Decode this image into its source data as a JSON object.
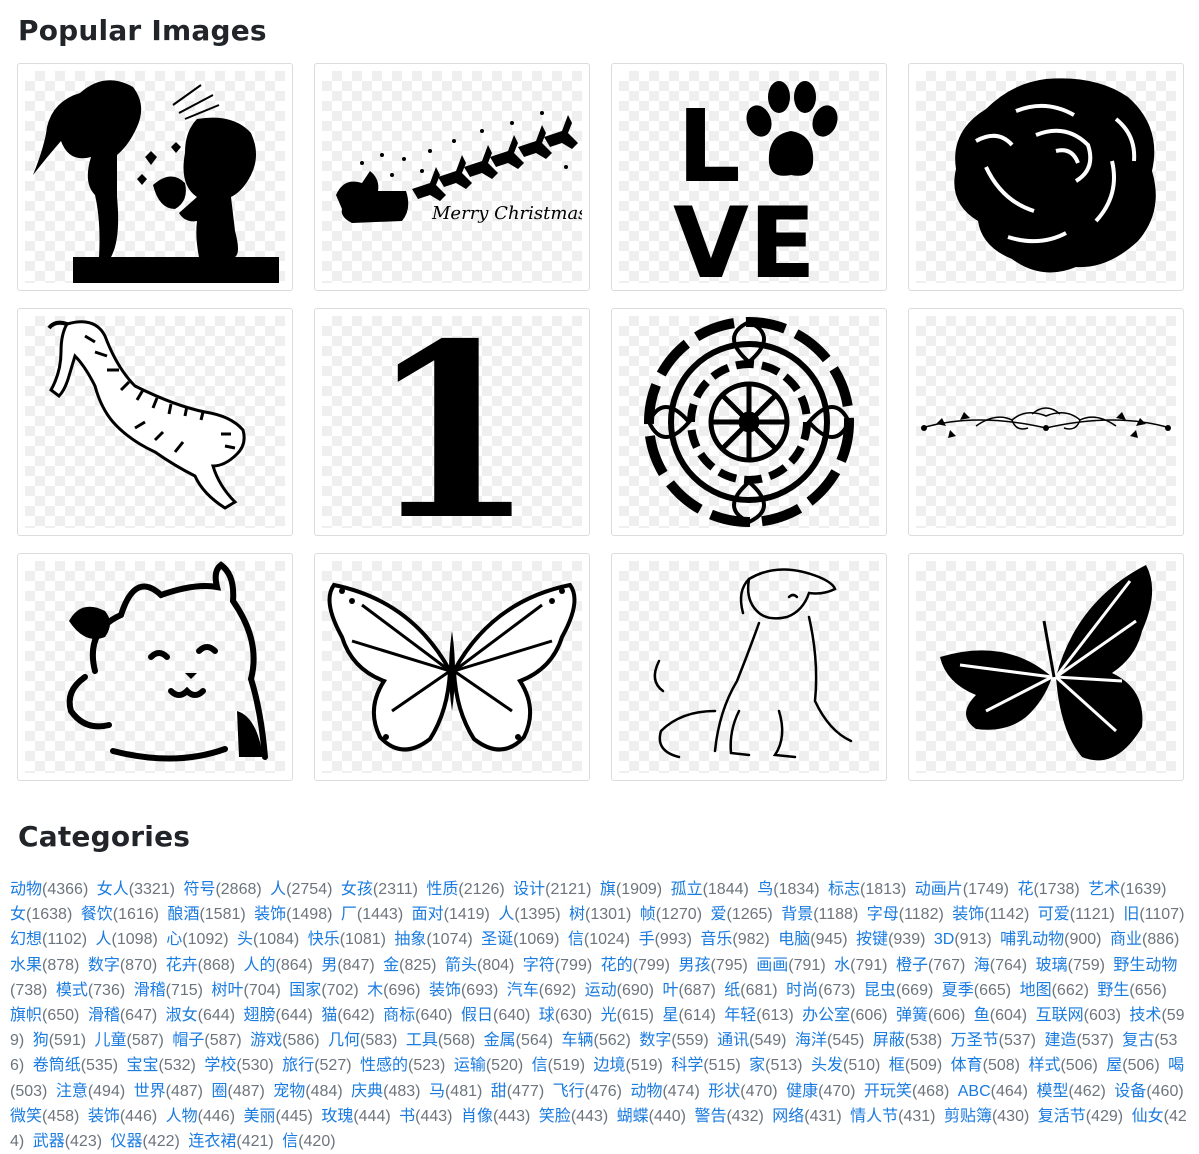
{
  "popular": {
    "title": "Popular Images",
    "images": [
      {
        "icon": "couple-silhouette-icon"
      },
      {
        "icon": "santa-sleigh-icon",
        "caption": "Merry Christmas"
      },
      {
        "icon": "love-paw-icon",
        "letters_top": "L",
        "letters_bottom": "VE"
      },
      {
        "icon": "rose-icon"
      },
      {
        "icon": "tiger-icon"
      },
      {
        "icon": "number-one-icon",
        "text": "1"
      },
      {
        "icon": "mandala-icon"
      },
      {
        "icon": "floral-divider-icon"
      },
      {
        "icon": "lucky-cat-icon"
      },
      {
        "icon": "butterfly-outline-icon"
      },
      {
        "icon": "dog-line-art-icon"
      },
      {
        "icon": "butterfly-silhouette-icon"
      }
    ]
  },
  "categories": {
    "title": "Categories",
    "link_color": "#1a7be0",
    "items": [
      {
        "name": "动物",
        "count": "(4366)"
      },
      {
        "name": "女人",
        "count": "(3321)"
      },
      {
        "name": "符号",
        "count": "(2868)"
      },
      {
        "name": "人",
        "count": "(2754)"
      },
      {
        "name": "女孩",
        "count": "(2311)"
      },
      {
        "name": "性质",
        "count": "(2126)"
      },
      {
        "name": "设计",
        "count": "(2121)"
      },
      {
        "name": "旗",
        "count": "(1909)"
      },
      {
        "name": "孤立",
        "count": "(1844)"
      },
      {
        "name": "鸟",
        "count": "(1834)"
      },
      {
        "name": "标志",
        "count": "(1813)"
      },
      {
        "name": "动画片",
        "count": "(1749)"
      },
      {
        "name": "花",
        "count": "(1738)"
      },
      {
        "name": "艺术",
        "count": "(1639)"
      },
      {
        "name": "女",
        "count": "(1638)"
      },
      {
        "name": "餐饮",
        "count": "(1616)"
      },
      {
        "name": "酿酒",
        "count": "(1581)"
      },
      {
        "name": "装饰",
        "count": "(1498)"
      },
      {
        "name": "厂",
        "count": "(1443)"
      },
      {
        "name": "面对",
        "count": "(1419)"
      },
      {
        "name": "人",
        "count": "(1395)"
      },
      {
        "name": "树",
        "count": "(1301)"
      },
      {
        "name": "帧",
        "count": "(1270)"
      },
      {
        "name": "爱",
        "count": "(1265)"
      },
      {
        "name": "背景",
        "count": "(1188)"
      },
      {
        "name": "字母",
        "count": "(1182)"
      },
      {
        "name": "装饰",
        "count": "(1142)"
      },
      {
        "name": "可爱",
        "count": "(1121)"
      },
      {
        "name": "旧",
        "count": "(1107)"
      },
      {
        "name": "幻想",
        "count": "(1102)"
      },
      {
        "name": "人",
        "count": "(1098)"
      },
      {
        "name": "心",
        "count": "(1092)"
      },
      {
        "name": "头",
        "count": "(1084)"
      },
      {
        "name": "快乐",
        "count": "(1081)"
      },
      {
        "name": "抽象",
        "count": "(1074)"
      },
      {
        "name": "圣诞",
        "count": "(1069)"
      },
      {
        "name": "信",
        "count": "(1024)"
      },
      {
        "name": "手",
        "count": "(993)"
      },
      {
        "name": "音乐",
        "count": "(982)"
      },
      {
        "name": "电脑",
        "count": "(945)"
      },
      {
        "name": "按键",
        "count": "(939)"
      },
      {
        "name": "3D",
        "count": "(913)"
      },
      {
        "name": "哺乳动物",
        "count": "(900)"
      },
      {
        "name": "商业",
        "count": "(886)"
      },
      {
        "name": "水果",
        "count": "(878)"
      },
      {
        "name": "数字",
        "count": "(870)"
      },
      {
        "name": "花卉",
        "count": "(868)"
      },
      {
        "name": "人的",
        "count": "(864)"
      },
      {
        "name": "男",
        "count": "(847)"
      },
      {
        "name": "金",
        "count": "(825)"
      },
      {
        "name": "箭头",
        "count": "(804)"
      },
      {
        "name": "字符",
        "count": "(799)"
      },
      {
        "name": "花的",
        "count": "(799)"
      },
      {
        "name": "男孩",
        "count": "(795)"
      },
      {
        "name": "画画",
        "count": "(791)"
      },
      {
        "name": "水",
        "count": "(791)"
      },
      {
        "name": "橙子",
        "count": "(767)"
      },
      {
        "name": "海",
        "count": "(764)"
      },
      {
        "name": "玻璃",
        "count": "(759)"
      },
      {
        "name": "野生动物",
        "count": "(738)"
      },
      {
        "name": "模式",
        "count": "(736)"
      },
      {
        "name": "滑稽",
        "count": "(715)"
      },
      {
        "name": "树叶",
        "count": "(704)"
      },
      {
        "name": "国家",
        "count": "(702)"
      },
      {
        "name": "木",
        "count": "(696)"
      },
      {
        "name": "装饰",
        "count": "(693)"
      },
      {
        "name": "汽车",
        "count": "(692)"
      },
      {
        "name": "运动",
        "count": "(690)"
      },
      {
        "name": "叶",
        "count": "(687)"
      },
      {
        "name": "纸",
        "count": "(681)"
      },
      {
        "name": "时尚",
        "count": "(673)"
      },
      {
        "name": "昆虫",
        "count": "(669)"
      },
      {
        "name": "夏季",
        "count": "(665)"
      },
      {
        "name": "地图",
        "count": "(662)"
      },
      {
        "name": "野生",
        "count": "(656)"
      },
      {
        "name": "旗帜",
        "count": "(650)"
      },
      {
        "name": "滑稽",
        "count": "(647)"
      },
      {
        "name": "淑女",
        "count": "(644)"
      },
      {
        "name": "翅膀",
        "count": "(644)"
      },
      {
        "name": "猫",
        "count": "(642)"
      },
      {
        "name": "商标",
        "count": "(640)"
      },
      {
        "name": "假日",
        "count": "(640)"
      },
      {
        "name": "球",
        "count": "(630)"
      },
      {
        "name": "光",
        "count": "(615)"
      },
      {
        "name": "星",
        "count": "(614)"
      },
      {
        "name": "年轻",
        "count": "(613)"
      },
      {
        "name": "办公室",
        "count": "(606)"
      },
      {
        "name": "弹簧",
        "count": "(606)"
      },
      {
        "name": "鱼",
        "count": "(604)"
      },
      {
        "name": "互联网",
        "count": "(603)"
      },
      {
        "name": "技术",
        "count": "(599)"
      },
      {
        "name": "狗",
        "count": "(591)"
      },
      {
        "name": "儿童",
        "count": "(587)"
      },
      {
        "name": "帽子",
        "count": "(587)"
      },
      {
        "name": "游戏",
        "count": "(586)"
      },
      {
        "name": "几何",
        "count": "(583)"
      },
      {
        "name": "工具",
        "count": "(568)"
      },
      {
        "name": "金属",
        "count": "(564)"
      },
      {
        "name": "车辆",
        "count": "(562)"
      },
      {
        "name": "数字",
        "count": "(559)"
      },
      {
        "name": "通讯",
        "count": "(549)"
      },
      {
        "name": "海洋",
        "count": "(545)"
      },
      {
        "name": "屏蔽",
        "count": "(538)"
      },
      {
        "name": "万圣节",
        "count": "(537)"
      },
      {
        "name": "建造",
        "count": "(537)"
      },
      {
        "name": "复古",
        "count": "(536)"
      },
      {
        "name": "卷筒纸",
        "count": "(535)"
      },
      {
        "name": "宝宝",
        "count": "(532)"
      },
      {
        "name": "学校",
        "count": "(530)"
      },
      {
        "name": "旅行",
        "count": "(527)"
      },
      {
        "name": "性感的",
        "count": "(523)"
      },
      {
        "name": "运输",
        "count": "(520)"
      },
      {
        "name": "信",
        "count": "(519)"
      },
      {
        "name": "边境",
        "count": "(519)"
      },
      {
        "name": "科学",
        "count": "(515)"
      },
      {
        "name": "家",
        "count": "(513)"
      },
      {
        "name": "头发",
        "count": "(510)"
      },
      {
        "name": "框",
        "count": "(509)"
      },
      {
        "name": "体育",
        "count": "(508)"
      },
      {
        "name": "样式",
        "count": "(506)"
      },
      {
        "name": "屋",
        "count": "(506)"
      },
      {
        "name": "喝",
        "count": "(503)"
      },
      {
        "name": "注意",
        "count": "(494)"
      },
      {
        "name": "世界",
        "count": "(487)"
      },
      {
        "name": "圈",
        "count": "(487)"
      },
      {
        "name": "宠物",
        "count": "(484)"
      },
      {
        "name": "庆典",
        "count": "(483)"
      },
      {
        "name": "马",
        "count": "(481)"
      },
      {
        "name": "甜",
        "count": "(477)"
      },
      {
        "name": "飞行",
        "count": "(476)"
      },
      {
        "name": "动物",
        "count": "(474)"
      },
      {
        "name": "形状",
        "count": "(470)"
      },
      {
        "name": "健康",
        "count": "(470)"
      },
      {
        "name": "开玩笑",
        "count": "(468)"
      },
      {
        "name": "ABC",
        "count": "(464)"
      },
      {
        "name": "模型",
        "count": "(462)"
      },
      {
        "name": "设备",
        "count": "(460)"
      },
      {
        "name": "微笑",
        "count": "(458)"
      },
      {
        "name": "装饰",
        "count": "(446)"
      },
      {
        "name": "人物",
        "count": "(446)"
      },
      {
        "name": "美丽",
        "count": "(445)"
      },
      {
        "name": "玫瑰",
        "count": "(444)"
      },
      {
        "name": "书",
        "count": "(443)"
      },
      {
        "name": "肖像",
        "count": "(443)"
      },
      {
        "name": "笑脸",
        "count": "(443)"
      },
      {
        "name": "蝴蝶",
        "count": "(440)"
      },
      {
        "name": "警告",
        "count": "(432)"
      },
      {
        "name": "网络",
        "count": "(431)"
      },
      {
        "name": "情人节",
        "count": "(431)"
      },
      {
        "name": "剪贴簿",
        "count": "(430)"
      },
      {
        "name": "复活节",
        "count": "(429)"
      },
      {
        "name": "仙女",
        "count": "(424)"
      },
      {
        "name": "武器",
        "count": "(423)"
      },
      {
        "name": "仪器",
        "count": "(422)"
      },
      {
        "name": "连衣裙",
        "count": "(421)"
      },
      {
        "name": "信",
        "count": "(420)"
      }
    ]
  }
}
